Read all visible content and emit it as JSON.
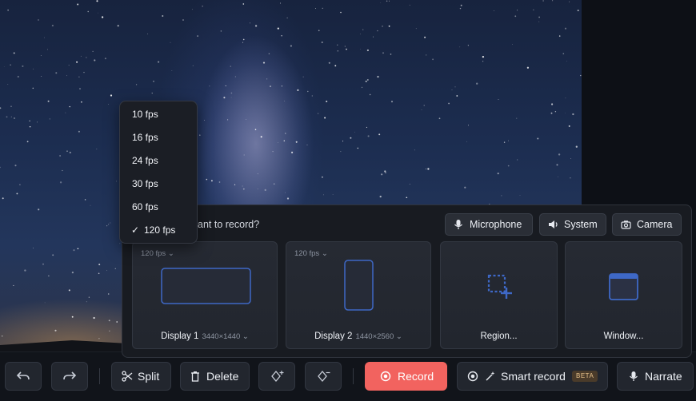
{
  "fps_menu": {
    "items": [
      "10 fps",
      "16 fps",
      "24 fps",
      "30 fps",
      "60 fps",
      "120 fps"
    ],
    "selected_index": 5,
    "check": "✓"
  },
  "panel": {
    "question": "want to record?",
    "sources": [
      {
        "label": "Microphone",
        "icon": "microphone-icon"
      },
      {
        "label": "System",
        "icon": "speaker-icon"
      },
      {
        "label": "Camera",
        "icon": "camera-icon"
      }
    ],
    "cards": [
      {
        "name": "Display 1",
        "fps": "120 fps",
        "resolution": "3440×1440",
        "icon": "display-landscape-icon"
      },
      {
        "name": "Display 2",
        "fps": "120 fps",
        "resolution": "1440×2560",
        "icon": "display-portrait-icon"
      },
      {
        "name": "Region...",
        "icon": "region-select-icon"
      },
      {
        "name": "Window...",
        "icon": "window-icon"
      }
    ]
  },
  "toolbar": {
    "undo_icon": "undo-icon",
    "redo_icon": "redo-icon",
    "split": "Split",
    "delete": "Delete",
    "add_keyframe_icon": "add-marker-icon",
    "remove_keyframe_icon": "remove-marker-icon",
    "record": "Record",
    "smart_record": "Smart record",
    "beta": "BETA",
    "narrate": "Narrate"
  },
  "colors": {
    "accent_record": "#f2635f",
    "panel_bg": "#181b21",
    "display_outline": "#3e68c6"
  }
}
